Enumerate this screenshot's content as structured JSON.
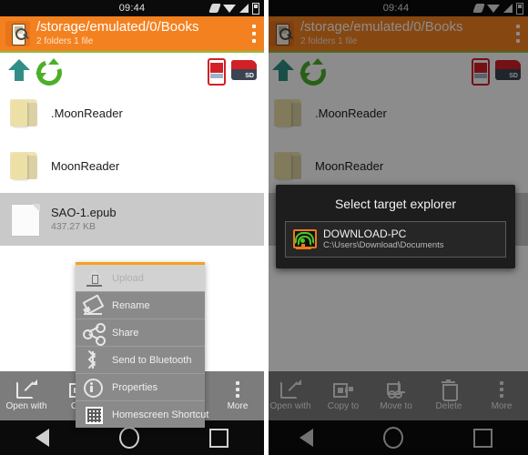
{
  "status_bar": {
    "time": "09:44",
    "icons": [
      "vibrate-icon",
      "wifi-icon",
      "signal-icon",
      "battery-icon"
    ]
  },
  "app_bar": {
    "icon": "file-explorer-icon",
    "path": "/storage/emulated/0/Books",
    "subtitle": "2 folders 1 file",
    "overflow": "overflow-menu-icon",
    "bg_color": "#f48120",
    "accent_color": "#8dbf3e"
  },
  "tool_row": {
    "up_label": "up-icon",
    "refresh_label": "refresh-icon",
    "phone_storage_label": "phone-storage-icon",
    "sd_card_label": "SD"
  },
  "file_list": [
    {
      "name": ".MoonReader",
      "size": "",
      "type": "folder",
      "selected": false
    },
    {
      "name": "MoonReader",
      "size": "",
      "type": "folder",
      "selected": false
    },
    {
      "name": "SAO-1.epub",
      "size": "437.27 KB",
      "type": "file",
      "selected": true
    }
  ],
  "context_menu": {
    "items": [
      {
        "label": "Upload",
        "icon": "upload-icon",
        "highlighted": true
      },
      {
        "label": "Rename",
        "icon": "pencil-icon",
        "highlighted": false
      },
      {
        "label": "Share",
        "icon": "share-icon",
        "highlighted": false
      },
      {
        "label": "Send to Bluetooth",
        "icon": "bluetooth-icon",
        "highlighted": false
      },
      {
        "label": "Properties",
        "icon": "info-icon",
        "highlighted": false
      },
      {
        "label": "Homescreen Shortcut",
        "icon": "grid-icon",
        "highlighted": false
      }
    ]
  },
  "action_bar_left": [
    {
      "label": "Open with",
      "icon": "open-with-icon"
    },
    {
      "label": "Cop",
      "icon": "copy-to-icon"
    },
    {
      "label": "More",
      "icon": "more-icon"
    }
  ],
  "action_bar_right": [
    {
      "label": "Open with",
      "icon": "open-with-icon"
    },
    {
      "label": "Copy to",
      "icon": "copy-to-icon"
    },
    {
      "label": "Move to",
      "icon": "move-to-icon"
    },
    {
      "label": "Delete",
      "icon": "trash-icon"
    },
    {
      "label": "More",
      "icon": "more-icon"
    }
  ],
  "dialog": {
    "title": "Select target explorer",
    "entries": [
      {
        "name": "DOWNLOAD-PC",
        "path": "C:\\Users\\Download\\Documents",
        "icon": "pc-wifi-icon"
      }
    ]
  },
  "nav_bar": {
    "back": "back-triangle-icon",
    "home": "home-circle-icon",
    "recents": "recents-square-icon"
  }
}
